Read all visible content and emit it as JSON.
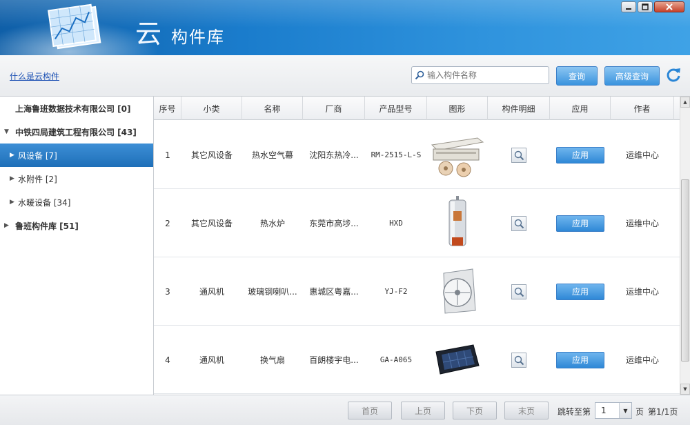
{
  "window": {
    "app_name_glyph": "云",
    "app_name": "构件库",
    "controls": [
      "minimize",
      "maximize",
      "close"
    ]
  },
  "toolbar": {
    "help_link": "什么是云构件",
    "search_placeholder": "输入构件名称",
    "search_value": "",
    "query_button": "查询",
    "advanced_query_button": "高级查询",
    "refresh_icon": "refresh-icon"
  },
  "sidebar": {
    "items": [
      {
        "label": "上海鲁班数据技术有限公司 [0]",
        "level": 0,
        "arrow": ""
      },
      {
        "label": "中铁四局建筑工程有限公司 [43]",
        "level": 0,
        "arrow": "▼"
      },
      {
        "label": "风设备 [7]",
        "level": 1,
        "arrow": "▶",
        "selected": true
      },
      {
        "label": "水附件 [2]",
        "level": 1,
        "arrow": "▶"
      },
      {
        "label": "水暖设备 [34]",
        "level": 1,
        "arrow": "▶"
      },
      {
        "label": "鲁班构件库 [51]",
        "level": 0,
        "arrow": "▶"
      }
    ]
  },
  "table": {
    "columns": [
      "序号",
      "小类",
      "名称",
      "厂商",
      "产品型号",
      "图形",
      "构件明细",
      "应用",
      "作者"
    ],
    "apply_label": "应用",
    "rows": [
      {
        "index": "1",
        "subtype": "其它风设备",
        "name": "热水空气幕",
        "maker": "沈阳东热冷...",
        "model": "RM-2515-L-S",
        "image": "air-curtain",
        "author": "运维中心"
      },
      {
        "index": "2",
        "subtype": "其它风设备",
        "name": "热水炉",
        "maker": "东莞市高埗...",
        "model": "HXD",
        "image": "water-heater",
        "author": "运维中心"
      },
      {
        "index": "3",
        "subtype": "通风机",
        "name": "玻璃钢喇叭...",
        "maker": "惠城区粤嘉...",
        "model": "YJ-F2",
        "image": "fan",
        "author": "运维中心"
      },
      {
        "index": "4",
        "subtype": "通风机",
        "name": "换气扇",
        "maker": "百朗楼宇电...",
        "model": "GA-A065",
        "image": "exhaust-fan",
        "author": "运维中心"
      }
    ]
  },
  "pagination": {
    "first": "首页",
    "prev": "上页",
    "next": "下页",
    "last": "末页",
    "jump_label": "跳转至第",
    "page_value": "1",
    "page_suffix": "页",
    "page_info": "第1/1页"
  }
}
